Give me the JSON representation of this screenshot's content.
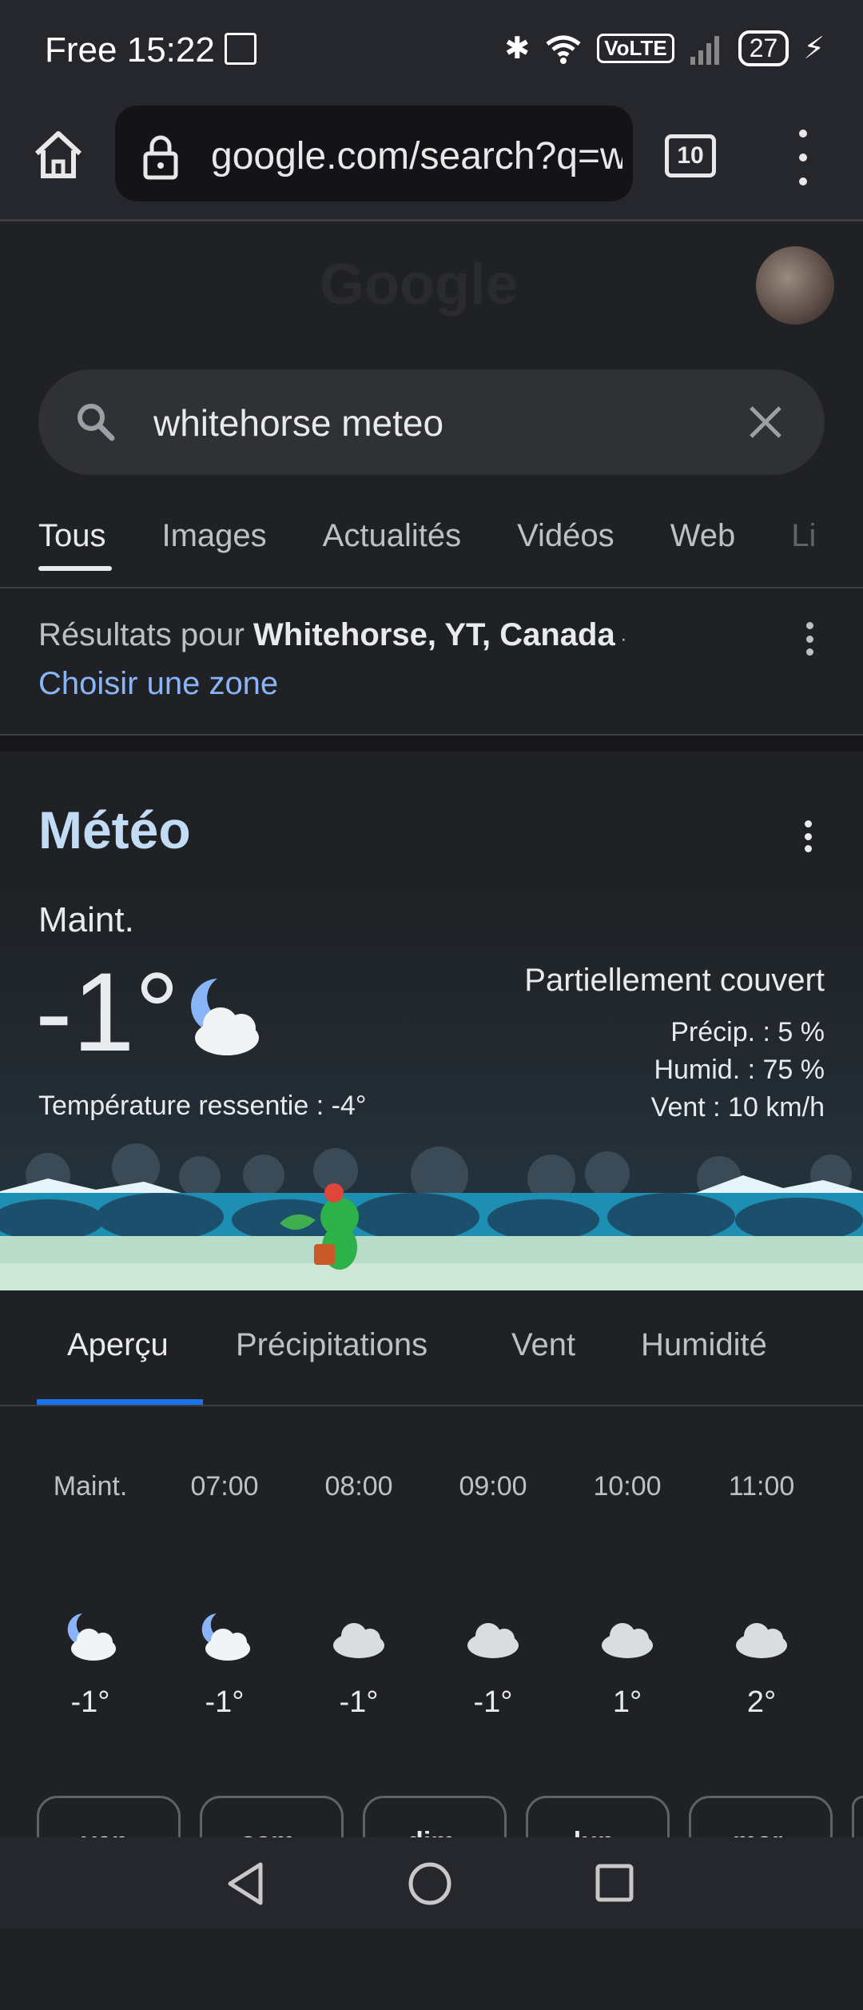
{
  "status_bar": {
    "carrier": "Free",
    "time": "15:22",
    "volte": "VoLTE",
    "battery": "27"
  },
  "browser": {
    "url": "google.com/search?q=w",
    "tab_count": "10"
  },
  "search": {
    "query": "whitehorse meteo"
  },
  "search_tabs": [
    "Tous",
    "Images",
    "Actualités",
    "Vidéos",
    "Web",
    "Li"
  ],
  "location": {
    "prefix": "Résultats pour ",
    "place": "Whitehorse, YT, Canada",
    "suffix": " ·",
    "change_link": "Choisir une zone"
  },
  "weather": {
    "title": "Météo",
    "now_label": "Maint.",
    "temperature": "-1°",
    "feels_like": "Température ressentie : -4°",
    "condition": "Partiellement couvert",
    "precip": "Précip. : 5 %",
    "humidity": "Humid. : 75 %",
    "wind": "Vent : 10 km/h",
    "tabs": [
      "Aperçu",
      "Précipitations",
      "Vent",
      "Humidité"
    ],
    "hourly": [
      {
        "time": "Maint.",
        "temp": "-1°",
        "icon": "moon-cloud-icon"
      },
      {
        "time": "07:00",
        "temp": "-1°",
        "icon": "moon-cloud-icon"
      },
      {
        "time": "08:00",
        "temp": "-1°",
        "icon": "cloud-icon"
      },
      {
        "time": "09:00",
        "temp": "-1°",
        "icon": "cloud-icon"
      },
      {
        "time": "10:00",
        "temp": "1°",
        "icon": "cloud-icon"
      },
      {
        "time": "11:00",
        "temp": "2°",
        "icon": "cloud-icon"
      }
    ],
    "days": [
      "ven.",
      "sam.",
      "dim.",
      "lun.",
      "mar."
    ]
  },
  "colors": {
    "accent_blue": "#1a73e8",
    "link_blue": "#8ab4f8",
    "title_blue": "#c2dcf5"
  }
}
